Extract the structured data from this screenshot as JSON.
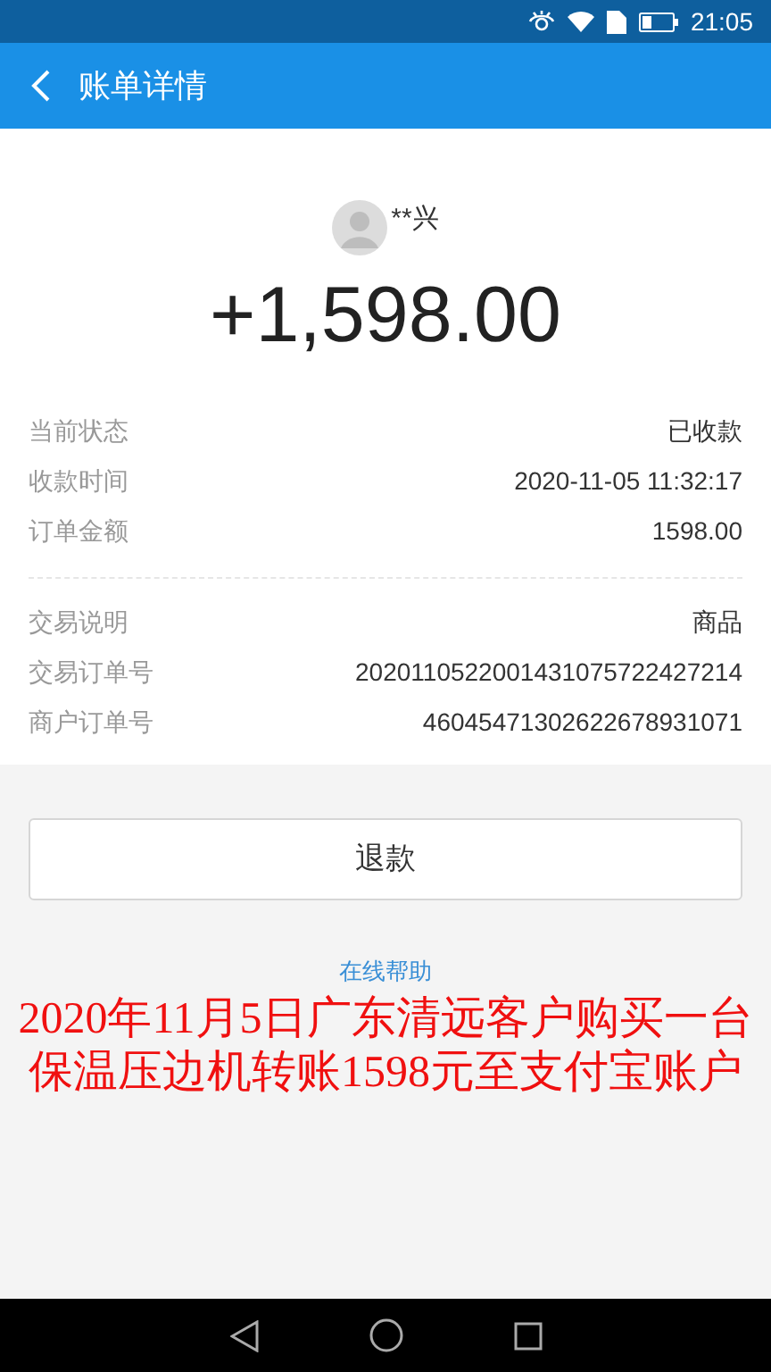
{
  "status_bar": {
    "time": "21:05"
  },
  "header": {
    "title": "账单详情"
  },
  "payer": {
    "name": "**兴"
  },
  "amount": "+1,598.00",
  "groups": [
    [
      {
        "label": "当前状态",
        "value": "已收款"
      },
      {
        "label": "收款时间",
        "value": "2020-11-05 11:32:17"
      },
      {
        "label": "订单金额",
        "value": "1598.00"
      }
    ],
    [
      {
        "label": "交易说明",
        "value": "商品"
      },
      {
        "label": "交易订单号",
        "value": "2020110522001431075722427214"
      },
      {
        "label": "商户订单号",
        "value": "46045471302622678931071"
      }
    ]
  ],
  "refund_button": "退款",
  "help_link": "在线帮助",
  "caption": [
    "2020年11月5日广东清远客户购买一台",
    "保温压边机转账1598元至支付宝账户"
  ]
}
